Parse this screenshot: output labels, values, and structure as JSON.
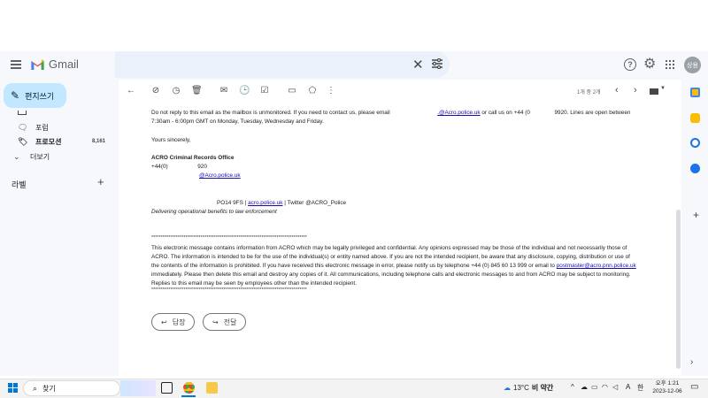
{
  "app": {
    "name": "Gmail"
  },
  "header": {
    "search_clear": "✕",
    "avatar_text": "상용"
  },
  "sidebar": {
    "compose_label": "편지쓰기",
    "items": [
      {
        "label": "포럼",
        "count": ""
      },
      {
        "label": "프로모션",
        "count": "8,161"
      },
      {
        "label": "더보기",
        "count": ""
      }
    ],
    "labels_title": "라벨"
  },
  "toolbar": {
    "pager_text": "1개 중 2개"
  },
  "email": {
    "line1_a": "Do not reply to this email as the mailbox is unmonitored. If you need to contact us, please email",
    "line1_link": ".@Acro.police.uk",
    "line1_b": "or call us on +44 (0",
    "line1_c": "9920. Lines are open between",
    "line2": "7:30am - 6:00pm GMT on Monday, Tuesday, Wednesday and Friday.",
    "closing": "Yours sincerely,",
    "org_name": "ACRO Criminal Records Office",
    "phone_a": "+44(0)",
    "phone_b": "920",
    "email_link": "@Acro.police.uk",
    "address_a": "PO14 9FS |",
    "address_link": "acro.police.uk",
    "address_b": "| Twitter @ACRO_Police",
    "tagline": "Delivering operational benefits to law enforcement",
    "stars": "**********************************************************************************",
    "disclaimer1": "This electronic message contains information from ACRO which may be legally privileged and confidential. Any opinions expressed may be those of the individual and not necessarily those of",
    "disclaimer2": "ACRO. The information is intended to be for the use of the individual(s) or entity named above. If you are not the intended recipient, be aware that any disclosure, copying, distribution or use of",
    "disclaimer3_a": "the contents of the information is prohibited. If you have received this electronic message in error, please notify us by telephone +44 (0) 845 60 13 999 or email to",
    "disclaimer3_link": "postmaster@acro.pnn.police.uk",
    "disclaimer4": "immediately. Please then delete this email and destroy any copies of it. All communications, including telephone calls and electronic messages to and from ACRO may be subject to monitoring.",
    "disclaimer5": "Replies to this email may be seen by employees other than the intended recipient."
  },
  "actions": {
    "reply_label": "답장",
    "forward_label": "전달"
  },
  "taskbar": {
    "search_label": "찾기",
    "weather_temp": "13°C",
    "weather_desc": "비 약간",
    "ime": "A",
    "lang": "한",
    "time": "오후 1:21",
    "date": "2023-12-06"
  }
}
